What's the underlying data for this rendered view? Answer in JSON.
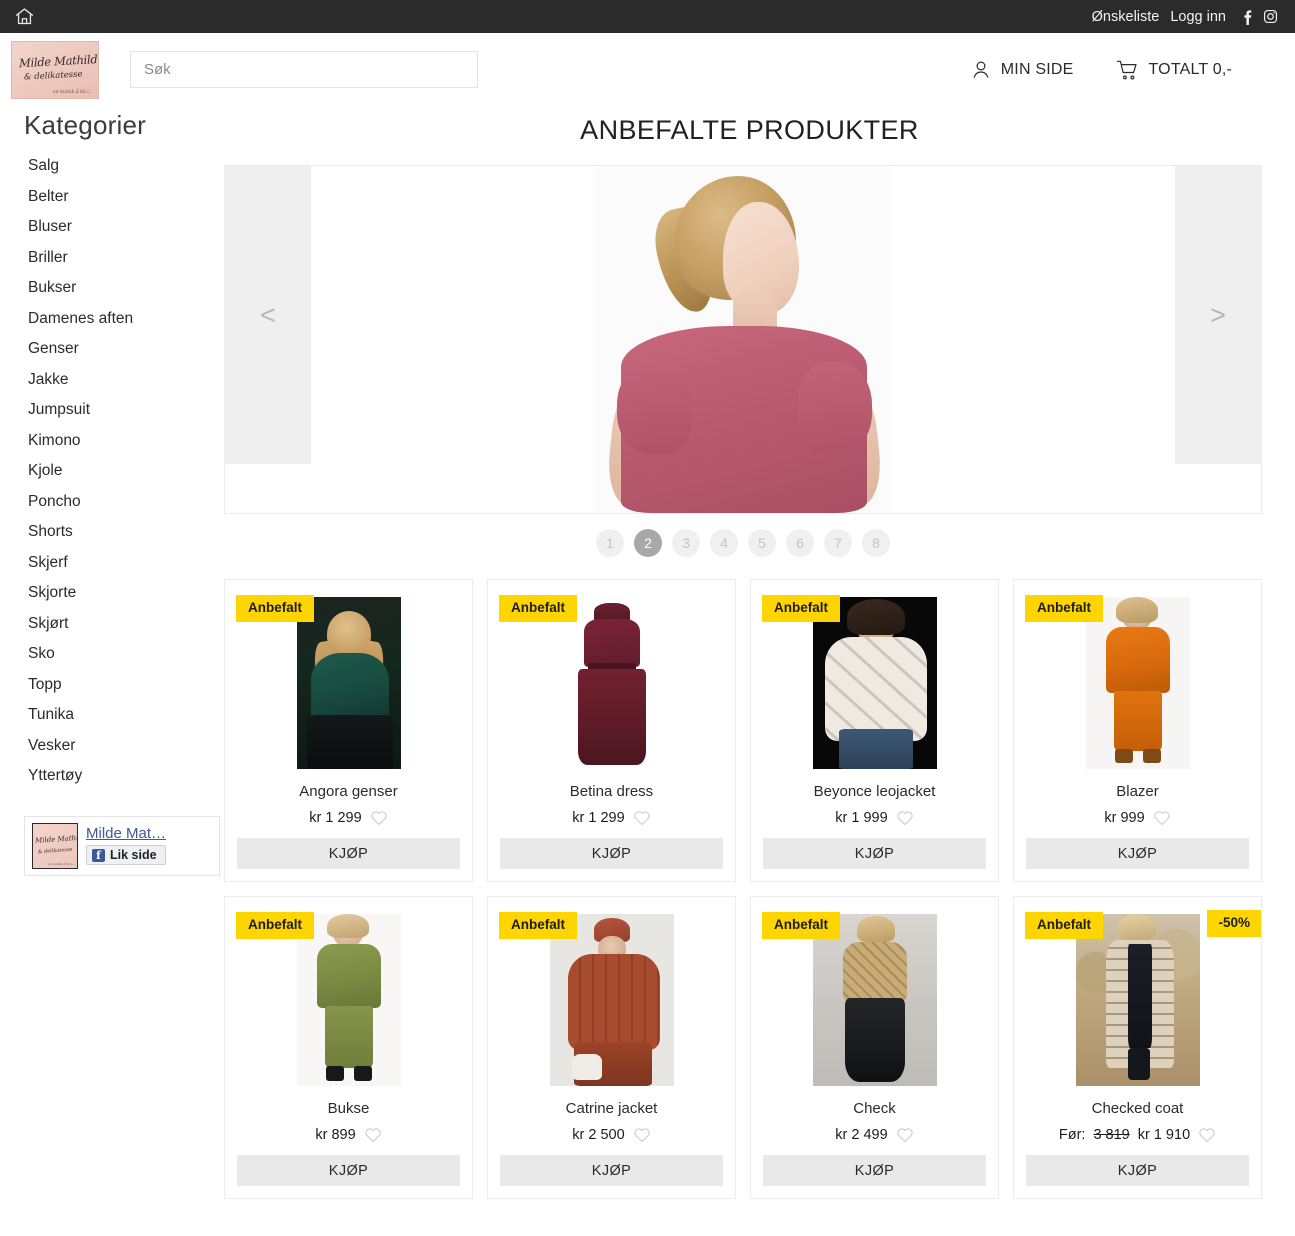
{
  "topbar": {
    "home_icon": "home-icon",
    "wishlist_label": "Ønskeliste",
    "login_label": "Logg inn",
    "facebook_icon": "facebook-icon",
    "instagram_icon": "instagram-icon"
  },
  "header": {
    "logo": {
      "line1": "Milde Mathilde",
      "line2": "& delikatesse",
      "line3": "en butikk å bli i..."
    },
    "search": {
      "placeholder": "Søk",
      "value": ""
    },
    "my_page_label": "MIN SIDE",
    "cart_label": "TOTALT 0,-"
  },
  "sidebar": {
    "title": "Kategorier",
    "items": [
      {
        "label": "Salg"
      },
      {
        "label": "Belter"
      },
      {
        "label": "Bluser"
      },
      {
        "label": "Briller"
      },
      {
        "label": "Bukser"
      },
      {
        "label": "Damenes aften"
      },
      {
        "label": "Genser"
      },
      {
        "label": "Jakke"
      },
      {
        "label": "Jumpsuit"
      },
      {
        "label": "Kimono"
      },
      {
        "label": "Kjole"
      },
      {
        "label": "Poncho"
      },
      {
        "label": "Shorts"
      },
      {
        "label": "Skjerf"
      },
      {
        "label": "Skjorte"
      },
      {
        "label": "Skjørt"
      },
      {
        "label": "Sko"
      },
      {
        "label": "Topp"
      },
      {
        "label": "Tunika"
      },
      {
        "label": "Vesker"
      },
      {
        "label": "Yttertøy"
      }
    ],
    "facebook_widget": {
      "page_name": "Milde Mat…",
      "like_label": "Lik side",
      "thumb_line1": "Milde Mathilde",
      "thumb_line2": "& delikatesse",
      "thumb_line3": "en butikk å bli i..."
    }
  },
  "main": {
    "title": "ANBEFALTE PRODUKTER",
    "carousel": {
      "prev_arrow": "<",
      "next_arrow": ">",
      "active_index": 1,
      "dots": [
        "1",
        "2",
        "3",
        "4",
        "5",
        "6",
        "7",
        "8"
      ]
    },
    "buy_label": "KJØP",
    "badge_label": "Anbefalt",
    "before_label": "Før:",
    "products": [
      {
        "name": "Angora genser",
        "price": "kr 1 299",
        "old_price": "",
        "discount": "",
        "badge": "Anbefalt"
      },
      {
        "name": "Betina dress",
        "price": "kr 1 299",
        "old_price": "",
        "discount": "",
        "badge": "Anbefalt"
      },
      {
        "name": "Beyonce leojacket",
        "price": "kr 1 999",
        "old_price": "",
        "discount": "",
        "badge": "Anbefalt"
      },
      {
        "name": "Blazer",
        "price": "kr 999",
        "old_price": "",
        "discount": "",
        "badge": "Anbefalt"
      },
      {
        "name": "Bukse",
        "price": "kr 899",
        "old_price": "",
        "discount": "",
        "badge": "Anbefalt"
      },
      {
        "name": "Catrine jacket",
        "price": "kr 2 500",
        "old_price": "",
        "discount": "",
        "badge": "Anbefalt"
      },
      {
        "name": "Check",
        "price": "kr 2 499",
        "old_price": "",
        "discount": "",
        "badge": "Anbefalt"
      },
      {
        "name": "Checked coat",
        "price": "kr 1 910",
        "old_price": "3 819",
        "discount": "-50%",
        "badge": "Anbefalt"
      }
    ]
  },
  "colors": {
    "topbar_bg": "#2b2b2b",
    "badge_yellow": "#ffd500",
    "buy_button": "#e9e9e9",
    "carousel_side": "#efefef",
    "facebook_blue": "#3b5998",
    "logo_pink": "#f0cdc2"
  }
}
